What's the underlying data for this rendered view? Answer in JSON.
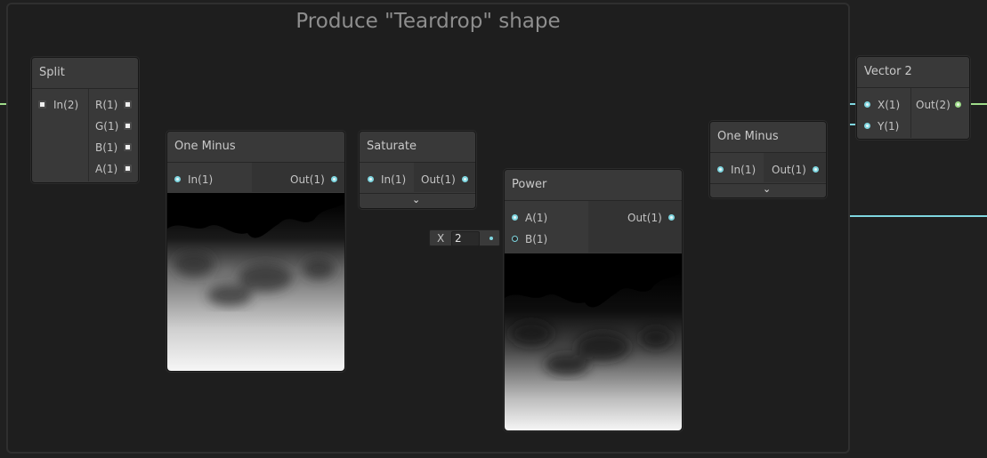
{
  "group": {
    "title": "Produce \"Teardrop\" shape"
  },
  "nodes": {
    "split": {
      "title": "Split",
      "inputs": [
        "In(2)"
      ],
      "outputs": [
        "R(1)",
        "G(1)",
        "B(1)",
        "A(1)"
      ]
    },
    "one_minus_1": {
      "title": "One Minus",
      "inputs": [
        "In(1)"
      ],
      "outputs": [
        "Out(1)"
      ]
    },
    "saturate": {
      "title": "Saturate",
      "inputs": [
        "In(1)"
      ],
      "outputs": [
        "Out(1)"
      ]
    },
    "power": {
      "title": "Power",
      "inputs": [
        "A(1)",
        "B(1)"
      ],
      "outputs": [
        "Out(1)"
      ],
      "b_input": {
        "axis_label": "X",
        "value": "2"
      }
    },
    "one_minus_2": {
      "title": "One Minus",
      "inputs": [
        "In(1)"
      ],
      "outputs": [
        "Out(1)"
      ]
    },
    "vector2": {
      "title": "Vector 2",
      "inputs": [
        "X(1)",
        "Y(1)"
      ],
      "outputs": [
        "Out(2)"
      ]
    }
  },
  "colors": {
    "wire": "#7fd6e0",
    "wire_green": "#9fdc8a",
    "node_bg": "#393939",
    "canvas_bg": "#202020"
  }
}
